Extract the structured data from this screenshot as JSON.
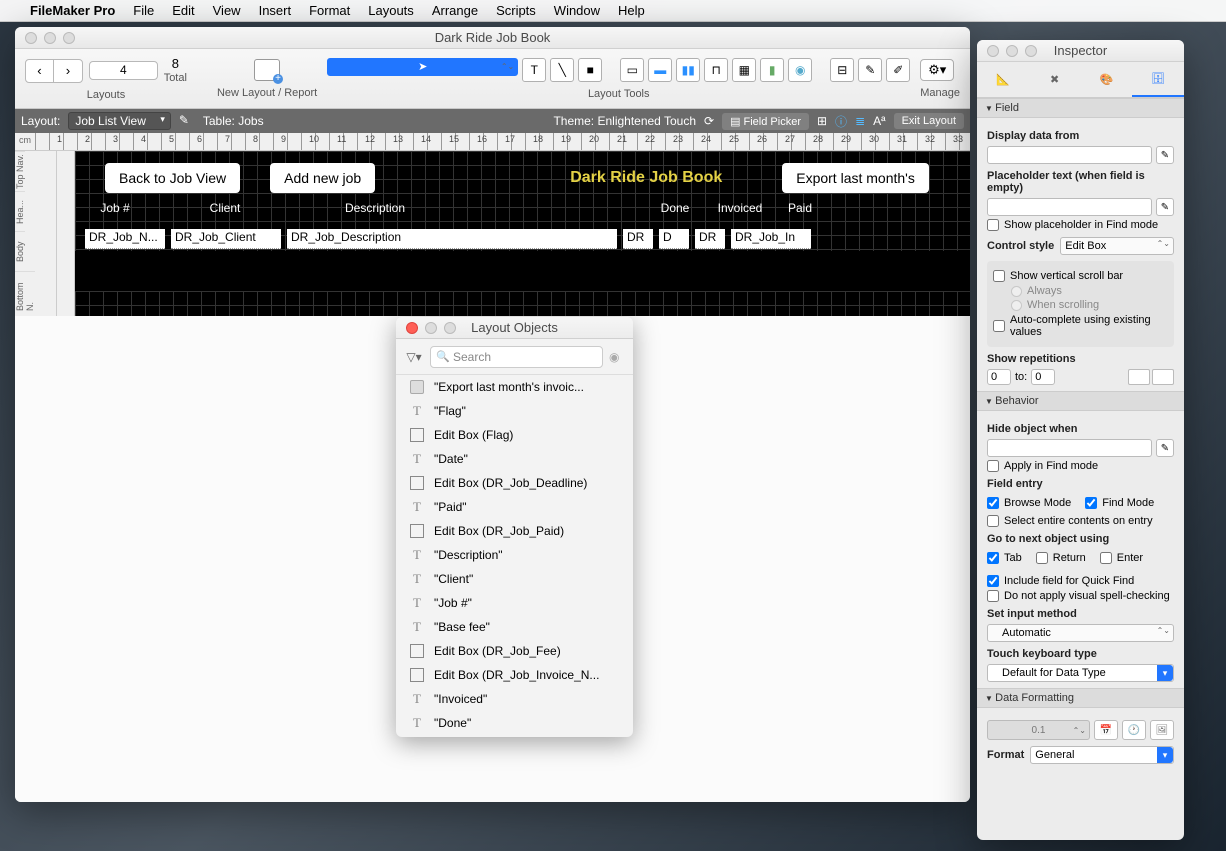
{
  "menubar": {
    "app": "FileMaker Pro",
    "items": [
      "File",
      "Edit",
      "View",
      "Insert",
      "Format",
      "Layouts",
      "Arrange",
      "Scripts",
      "Window",
      "Help"
    ]
  },
  "mainWindow": {
    "title": "Dark Ride Job Book",
    "nav": {
      "layoutNum": "4",
      "total": "8",
      "totalLabel": "Total",
      "layoutsLabel": "Layouts"
    },
    "newLayout": "New Layout / Report",
    "toolsLabel": "Layout Tools",
    "manage": "Manage",
    "status": {
      "layoutLabel": "Layout:",
      "layoutName": "Job List View",
      "tableLabel": "Table: Jobs",
      "theme": "Theme: Enlightened Touch",
      "fieldPicker": "Field Picker",
      "exit": "Exit Layout"
    },
    "rulerUnit": "cm",
    "parts": [
      "Top Nav.",
      "Hea...",
      "Body",
      "Bottom N."
    ],
    "canvas": {
      "btn1": "Back to Job View",
      "btn2": "Add new job",
      "title": "Dark Ride Job Book",
      "btn3": "Export last month's",
      "headers": {
        "jobno": "Job #",
        "client": "Client",
        "desc": "Description",
        "done": "Done",
        "invoiced": "Invoiced",
        "paid": "Paid"
      },
      "fields": [
        "DR_Job_N...",
        "DR_Job_Client",
        "DR_Job_Description",
        "DR",
        "D",
        "DR",
        "DR_Job_In"
      ]
    }
  },
  "objectsPanel": {
    "title": "Layout Objects",
    "searchPlaceholder": "Search",
    "items": [
      {
        "type": "btn",
        "label": "\"Export last month's invoic..."
      },
      {
        "type": "text",
        "label": "\"Flag\""
      },
      {
        "type": "edit",
        "label": "Edit Box (Flag)"
      },
      {
        "type": "text",
        "label": "\"Date\""
      },
      {
        "type": "edit",
        "label": "Edit Box (DR_Job_Deadline)"
      },
      {
        "type": "text",
        "label": "\"Paid\""
      },
      {
        "type": "edit",
        "label": "Edit Box (DR_Job_Paid)"
      },
      {
        "type": "text",
        "label": "\"Description\""
      },
      {
        "type": "text",
        "label": "\"Client\""
      },
      {
        "type": "text",
        "label": "\"Job #\""
      },
      {
        "type": "text",
        "label": "\"Base fee\""
      },
      {
        "type": "edit",
        "label": "Edit Box (DR_Job_Fee)"
      },
      {
        "type": "edit",
        "label": "Edit Box (DR_Job_Invoice_N..."
      },
      {
        "type": "text",
        "label": "\"Invoiced\""
      },
      {
        "type": "text",
        "label": "\"Done\""
      }
    ]
  },
  "inspector": {
    "title": "Inspector",
    "field": {
      "header": "Field",
      "displayDataFrom": "Display data from",
      "placeholderLabel": "Placeholder text (when field is empty)",
      "showPlaceholderFind": "Show placeholder in Find mode",
      "controlStyle": "Control style",
      "controlStyleVal": "Edit Box",
      "showVScroll": "Show vertical scroll bar",
      "always": "Always",
      "whenScrolling": "When scrolling",
      "autoComplete": "Auto-complete using existing values",
      "showReps": "Show repetitions",
      "repsFrom": "0",
      "repsToLabel": "to:",
      "repsTo": "0"
    },
    "behavior": {
      "header": "Behavior",
      "hideObjectWhen": "Hide object when",
      "applyFind": "Apply in Find mode",
      "fieldEntry": "Field entry",
      "browseMode": "Browse Mode",
      "findMode": "Find Mode",
      "selectEntire": "Select entire contents on entry",
      "gotoNext": "Go to next object using",
      "tab": "Tab",
      "return": "Return",
      "enter": "Enter",
      "includeQuickFind": "Include field for Quick Find",
      "noSpellCheck": "Do not apply visual spell-checking",
      "setInput": "Set input method",
      "automatic": "Automatic",
      "touchKbd": "Touch keyboard type",
      "touchKbdVal": "Default for Data Type"
    },
    "dataFmt": {
      "header": "Data Formatting",
      "formatLabel": "Format",
      "formatVal": "General"
    }
  }
}
